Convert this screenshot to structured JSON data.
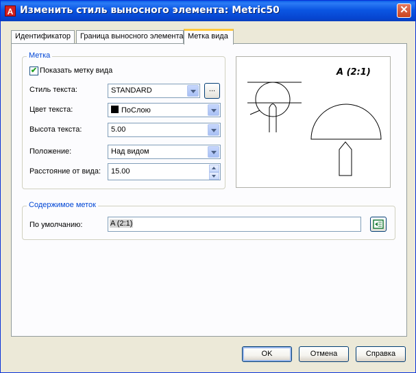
{
  "window": {
    "title": "Изменить стиль выносного элемента: Metric50",
    "app_icon_letter": "A"
  },
  "tabs": [
    {
      "label": "Идентификатор",
      "active": false
    },
    {
      "label": "Граница выносного элемента",
      "active": false
    },
    {
      "label": "Метка вида",
      "active": true
    }
  ],
  "label_group": {
    "title": "Метка",
    "show_view_label": {
      "label": "Показать метку вида",
      "checked": true
    },
    "text_style": {
      "label": "Стиль текста:",
      "value": "STANDARD",
      "browse_label": "..."
    },
    "text_color": {
      "label": "Цвет текста:",
      "value": "ПоСлою",
      "swatch_color": "#000000"
    },
    "text_height": {
      "label": "Высота текста:",
      "value": "5.00"
    },
    "position": {
      "label": "Положение:",
      "value": "Над видом"
    },
    "offset": {
      "label": "Расстояние от вида:",
      "value": "15.00"
    }
  },
  "preview": {
    "label_text": "A (2:1)"
  },
  "contents_group": {
    "title": "Содержимое меток",
    "default_label": "По умолчанию:",
    "default_value": "A (2:1)"
  },
  "buttons": {
    "ok": "OK",
    "cancel": "Отмена",
    "help": "Справка"
  }
}
